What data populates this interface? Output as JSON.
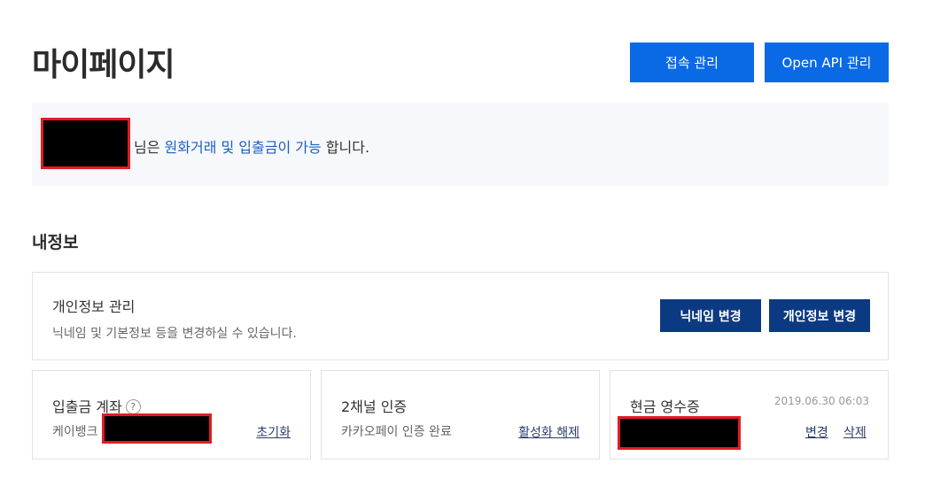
{
  "header": {
    "title": "마이페이지",
    "access_button": "접속 관리",
    "api_button": "Open API 관리"
  },
  "notice": {
    "prefix": " 님은 ",
    "highlight": "원화거래 및 입출금이 가능",
    "suffix": " 합니다."
  },
  "section": {
    "title": "내정보"
  },
  "personal_info": {
    "title": "개인정보 관리",
    "description": "닉네임 및 기본정보 등을 변경하실 수 있습니다.",
    "nickname_button": "닉네임 변경",
    "personal_button": "개인정보 변경"
  },
  "account": {
    "title": "입출금 계좌",
    "help_icon": "?",
    "bank": "케이뱅크",
    "reset_link": "초기화"
  },
  "auth": {
    "title": "2채널 인증",
    "status": "카카오페이 인증 완료",
    "deactivate_link": "활성화 해제"
  },
  "receipt": {
    "title": "현금 영수증",
    "timestamp": "2019.06.30 06:03",
    "change_link": "변경",
    "delete_link": "삭제"
  },
  "colors": {
    "primary": "#0a6ae6",
    "dark_button": "#0c3a82",
    "highlight_text": "#1d5fbf"
  }
}
